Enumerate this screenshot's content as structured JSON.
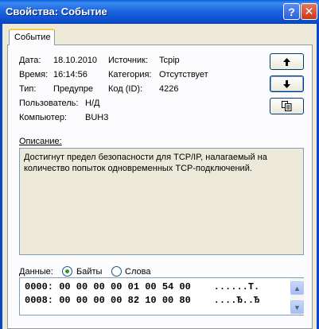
{
  "window": {
    "title": "Свойства: Событие",
    "help_glyph": "?",
    "close_glyph": "✕"
  },
  "tab": {
    "label": "Событие"
  },
  "fields": {
    "date_label": "Дата:",
    "date_value": "18.10.2010",
    "time_label": "Время:",
    "time_value": "16:14:56",
    "type_label": "Тип:",
    "type_value": "Предупре",
    "user_label": "Пользователь:",
    "user_value": "Н/Д",
    "computer_label": "Компьютер:",
    "computer_value": "BUH3",
    "source_label": "Источник:",
    "source_value": "Tcpip",
    "category_label": "Категория:",
    "category_value": "Отсутствует",
    "code_label": "Код (ID):",
    "code_value": "4226"
  },
  "nav_buttons": {
    "up_icon": "arrow-up-icon",
    "down_icon": "arrow-down-icon",
    "copy_icon": "copy-icon"
  },
  "description": {
    "label": "Описание:",
    "text": "Достигнут предел безопасности для TCP/IP, налагаемый  на\nколичество попыток одновременных TCP-подключений."
  },
  "data_section": {
    "label": "Данные:",
    "format_bytes": "Байты",
    "format_words": "Слова",
    "selected": "bytes",
    "lines": [
      "0000: 00 00 00 00 01 00 54 00    ......T.",
      "0008: 00 00 00 00 82 10 00 80    ....Ђ..Ђ"
    ]
  },
  "colors": {
    "title_bar": "#0a4fd0",
    "close_button": "#c8391b",
    "tab_accent": "#ffc83c",
    "panel_bg": "#fcfcfe",
    "radio_selected": "#21a121"
  }
}
